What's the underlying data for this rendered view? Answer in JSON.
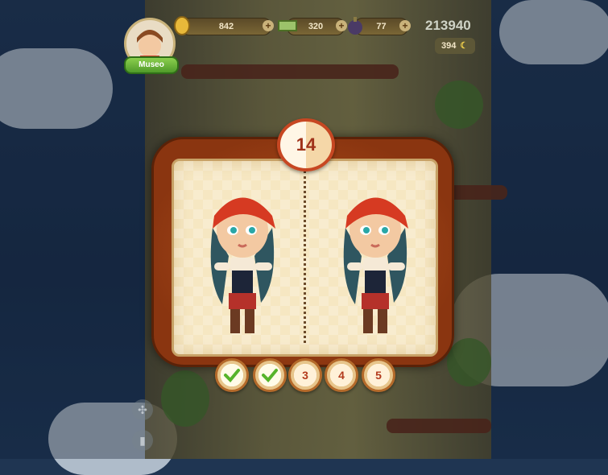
{
  "hud": {
    "player_label": "Museo",
    "coins": "842",
    "cash": "320",
    "bombs": "77",
    "score": "213940",
    "moon_count": "394"
  },
  "puzzle": {
    "level_number": "14",
    "rounds": [
      {
        "label": "",
        "state": "completed"
      },
      {
        "label": "",
        "state": "completed"
      },
      {
        "label": "3",
        "state": "pending"
      },
      {
        "label": "4",
        "state": "pending"
      },
      {
        "label": "5",
        "state": "pending"
      }
    ]
  },
  "icons": {
    "coin": "coin-icon",
    "cash": "cash-icon",
    "bomb": "bomb-icon",
    "moon": "moon-icon",
    "check": "check-icon",
    "expand": "expand-icon",
    "stats": "stats-icon",
    "add": "plus-icon"
  },
  "colors": {
    "frame": "#9a3f14",
    "page": "#f6e7c2",
    "badge_text": "#a0321a",
    "check": "#56b42a"
  }
}
